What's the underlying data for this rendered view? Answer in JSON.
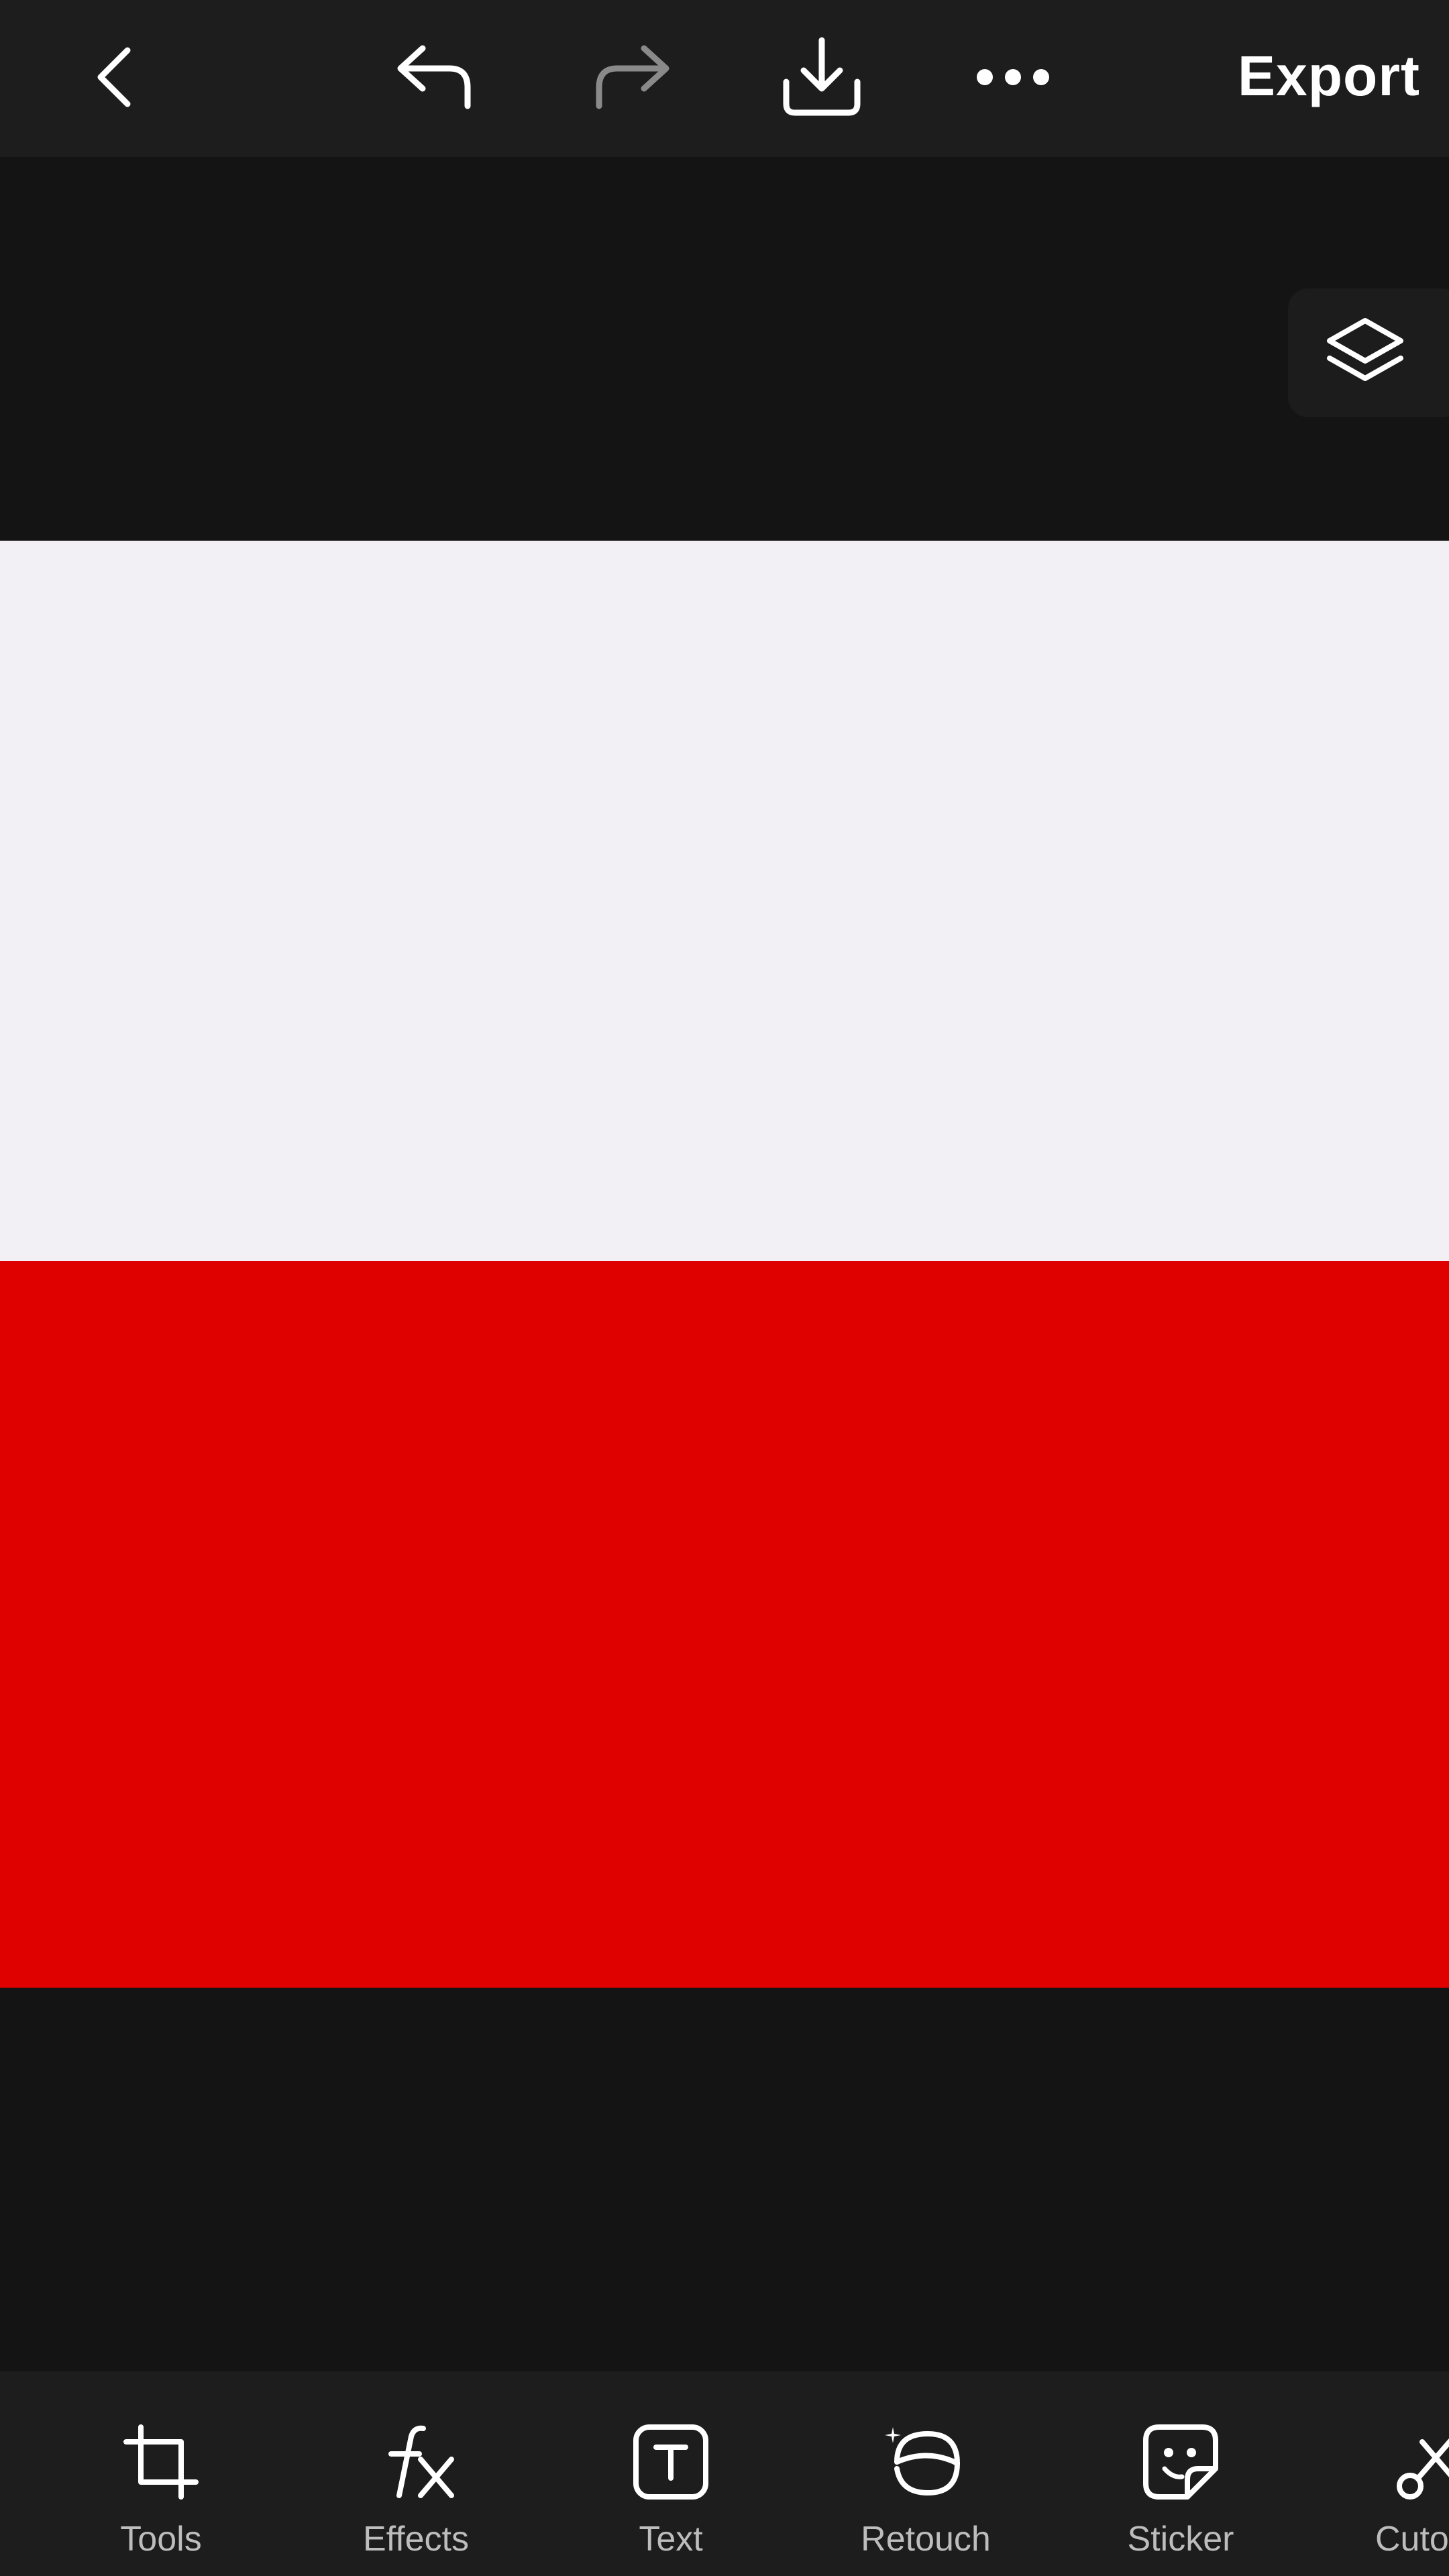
{
  "toolbar": {
    "back_icon": "chevron-left-icon",
    "undo_icon": "undo-icon",
    "redo_icon": "redo-icon",
    "download_icon": "download-icon",
    "more_icon": "more-dots-icon",
    "export_label": "Export"
  },
  "layers": {
    "icon": "layers-icon"
  },
  "canvas": {
    "stripe_top_color": "#f2f0f4",
    "stripe_bottom_color": "#df0000"
  },
  "bottom_tools": [
    {
      "label": "Tools",
      "icon": "crop-icon"
    },
    {
      "label": "Effects",
      "icon": "fx-icon"
    },
    {
      "label": "Text",
      "icon": "text-icon"
    },
    {
      "label": "Retouch",
      "icon": "retouch-icon"
    },
    {
      "label": "Sticker",
      "icon": "sticker-icon"
    },
    {
      "label": "Cuto",
      "icon": "scissors-icon"
    }
  ]
}
